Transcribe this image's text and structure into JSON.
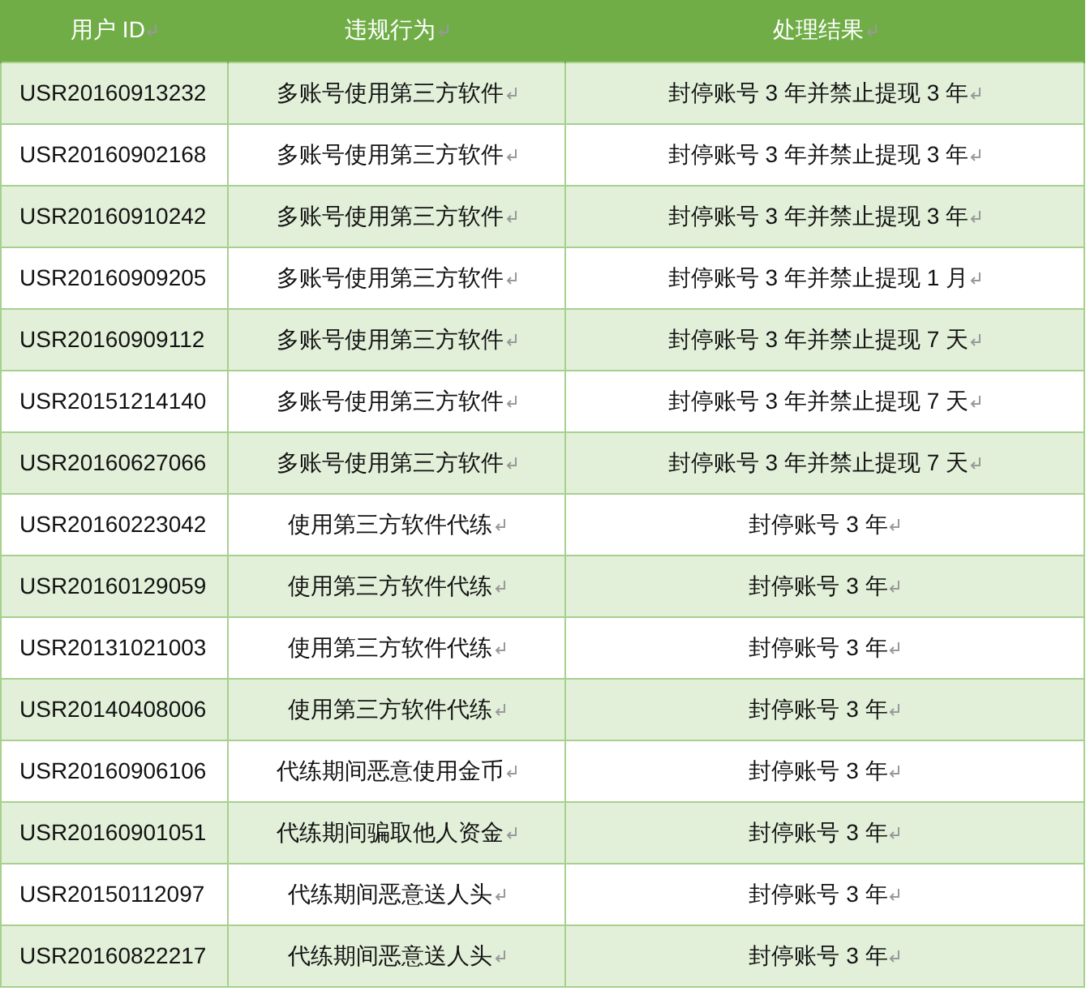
{
  "table": {
    "columns": [
      "用户 ID",
      "违规行为",
      "处理结果"
    ],
    "rows": [
      [
        "USR20160913232",
        "多账号使用第三方软件",
        "封停账号 3 年并禁止提现 3 年"
      ],
      [
        "USR20160902168",
        "多账号使用第三方软件",
        "封停账号 3 年并禁止提现 3 年"
      ],
      [
        "USR20160910242",
        "多账号使用第三方软件",
        "封停账号 3 年并禁止提现 3 年"
      ],
      [
        "USR20160909205",
        "多账号使用第三方软件",
        "封停账号 3 年并禁止提现 1 月"
      ],
      [
        "USR20160909112",
        "多账号使用第三方软件",
        "封停账号 3 年并禁止提现 7 天"
      ],
      [
        "USR20151214140",
        "多账号使用第三方软件",
        "封停账号 3 年并禁止提现 7 天"
      ],
      [
        "USR20160627066",
        "多账号使用第三方软件",
        "封停账号 3 年并禁止提现 7 天"
      ],
      [
        "USR20160223042",
        "使用第三方软件代练",
        "封停账号 3 年"
      ],
      [
        "USR20160129059",
        "使用第三方软件代练",
        "封停账号 3 年"
      ],
      [
        "USR20131021003",
        "使用第三方软件代练",
        "封停账号 3 年"
      ],
      [
        "USR20140408006",
        "使用第三方软件代练",
        "封停账号 3 年"
      ],
      [
        "USR20160906106",
        "代练期间恶意使用金币",
        "封停账号 3 年"
      ],
      [
        "USR20160901051",
        "代练期间骗取他人资金",
        "封停账号 3 年"
      ],
      [
        "USR20150112097",
        "代练期间恶意送人头",
        "封停账号 3 年"
      ],
      [
        "USR20160822217",
        "代练期间恶意送人头",
        "封停账号 3 年"
      ]
    ]
  }
}
